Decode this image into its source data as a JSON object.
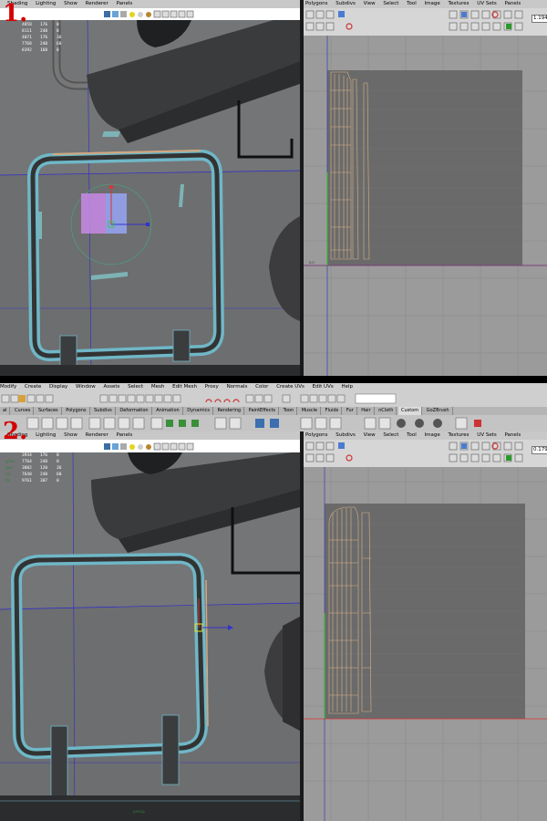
{
  "step_labels": [
    "1.",
    "2."
  ],
  "viewport_menu": [
    "Shading",
    "Lighting",
    "Show",
    "Renderer",
    "Panels"
  ],
  "uv_menu": [
    "Polygons",
    "Subdivs",
    "View",
    "Select",
    "Tool",
    "Image",
    "Textures",
    "UV Sets",
    "Panels"
  ],
  "main_menu": [
    "Modify",
    "Create",
    "Display",
    "Window",
    "Assets",
    "Select",
    "Mesh",
    "Edit Mesh",
    "Proxy",
    "Normals",
    "Color",
    "Create UVs",
    "Edit UVs",
    "Help"
  ],
  "shelf_tabs": [
    "al",
    "Curves",
    "Surfaces",
    "Polygons",
    "Subdivs",
    "Deformation",
    "Animation",
    "Dynamics",
    "Rendering",
    "PaintEffects",
    "Toon",
    "Muscle",
    "Fluids",
    "Fur",
    "Hair",
    "nCloth",
    "Custom",
    "GoZBrush"
  ],
  "shelf_active": "Custom",
  "panel1": {
    "hud": [
      {
        "label": "",
        "a": "4858",
        "b": "176",
        "c": "0"
      },
      {
        "label": "",
        "a": "8111",
        "b": "240",
        "c": "0"
      },
      {
        "label": "",
        "a": "4071",
        "b": "176",
        "c": "36"
      },
      {
        "label": "",
        "a": "7768",
        "b": "240",
        "c": "60"
      },
      {
        "label": "",
        "a": "8392",
        "b": "160",
        "c": "0"
      }
    ],
    "uv_zoom": "1.194"
  },
  "panel2": {
    "hud": [
      {
        "label": "",
        "a": "3934",
        "b": "176",
        "c": "0"
      },
      {
        "label": "gles",
        "a": "7764",
        "b": "240",
        "c": "0"
      },
      {
        "label": "ges",
        "a": "3882",
        "b": "120",
        "c": "36"
      },
      {
        "label": "es",
        "a": "7648",
        "b": "240",
        "c": "60"
      },
      {
        "label": "Vs",
        "a": "9761",
        "b": "307",
        "c": "0"
      }
    ],
    "uv_zoom": "0.179",
    "status_label": "persp"
  },
  "colors": {
    "step_red": "#d40000",
    "viewport_bg": "#6d6e70",
    "uv_bg": "#9b9b9b",
    "uv_tile": "#6a6a6a",
    "shell_wire": "#d9b48a",
    "hud_label": "#2f7f3b"
  }
}
